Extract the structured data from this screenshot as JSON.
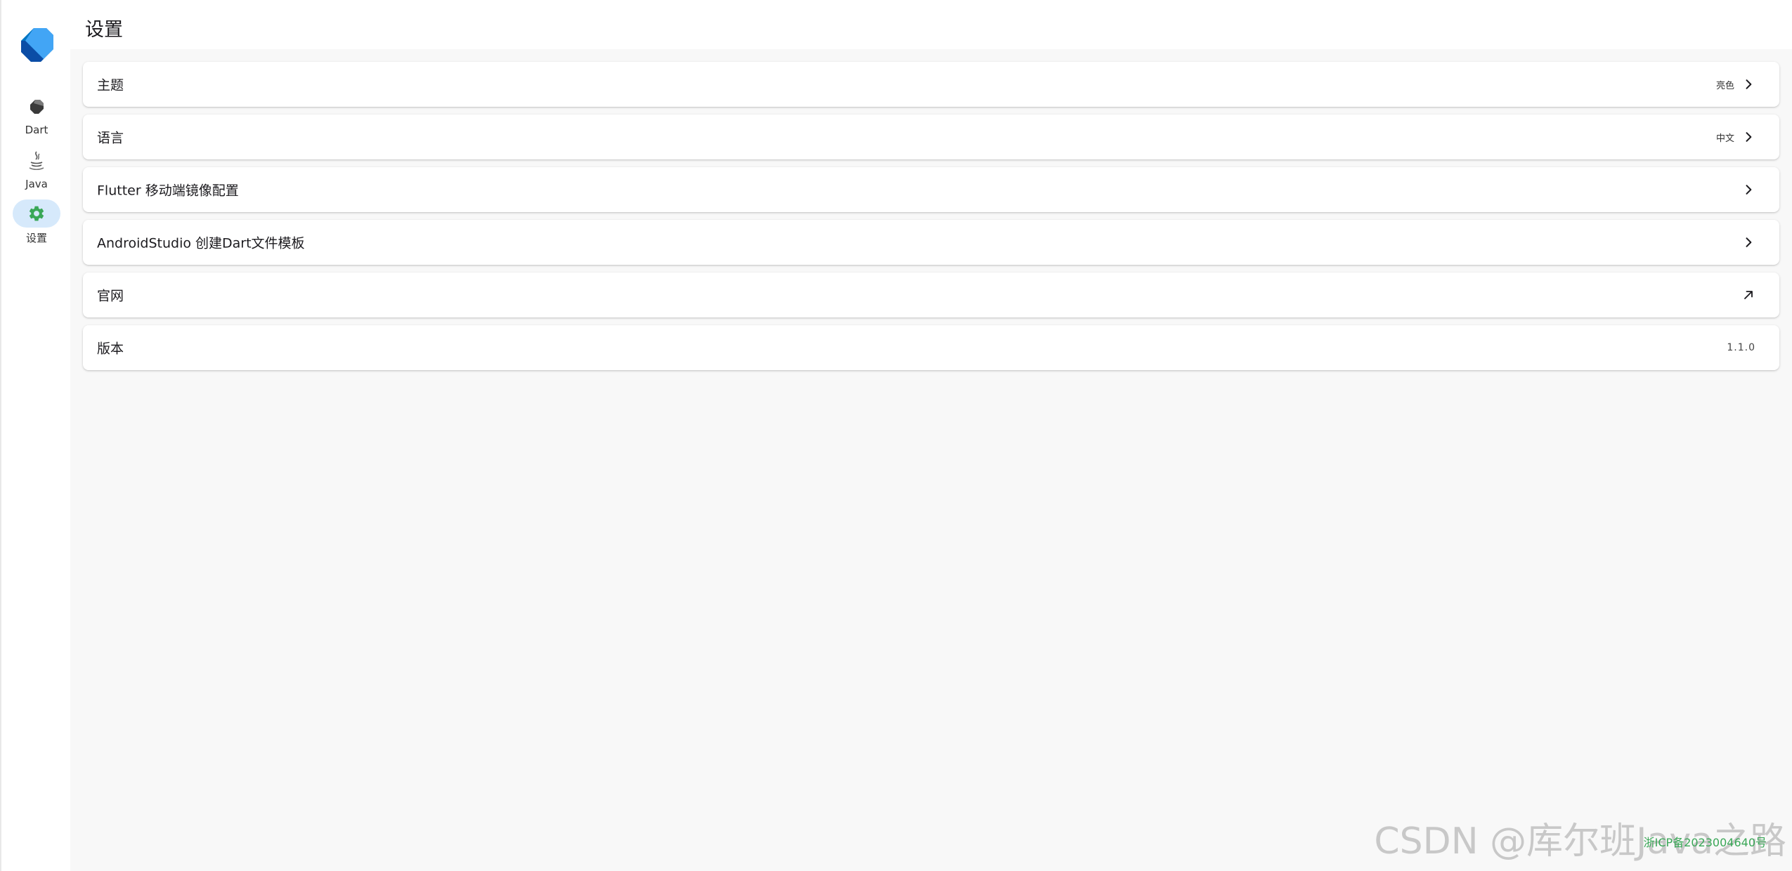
{
  "header": {
    "title": "设置"
  },
  "sidebar": {
    "logo_icon": "dart-logo-icon",
    "items": [
      {
        "label": "Dart",
        "icon": "dart-icon",
        "active": false
      },
      {
        "label": "Java",
        "icon": "java-icon",
        "active": false
      },
      {
        "label": "设置",
        "icon": "gear-icon",
        "active": true
      }
    ]
  },
  "settings": {
    "rows": [
      {
        "label": "主题",
        "value": "亮色",
        "icon": "chevron-right-icon"
      },
      {
        "label": "语言",
        "value": "中文",
        "icon": "chevron-right-icon"
      },
      {
        "label": "Flutter 移动端镜像配置",
        "value": "",
        "icon": "chevron-right-icon"
      },
      {
        "label": "AndroidStudio 创建Dart文件模板",
        "value": "",
        "icon": "chevron-right-icon"
      },
      {
        "label": "官网",
        "value": "",
        "icon": "arrow-up-right-icon"
      },
      {
        "label": "版本",
        "value": "1.1.0",
        "icon": ""
      }
    ]
  },
  "footer": {
    "icp": "浙ICP备2023004640号"
  },
  "watermark": "CSDN @库尔班Java之路",
  "colors": {
    "active_nav_bg": "#d6e9fb",
    "gear_active": "#3aa757",
    "page_bg": "#f8f8f8",
    "icp_link": "#3aa757"
  }
}
